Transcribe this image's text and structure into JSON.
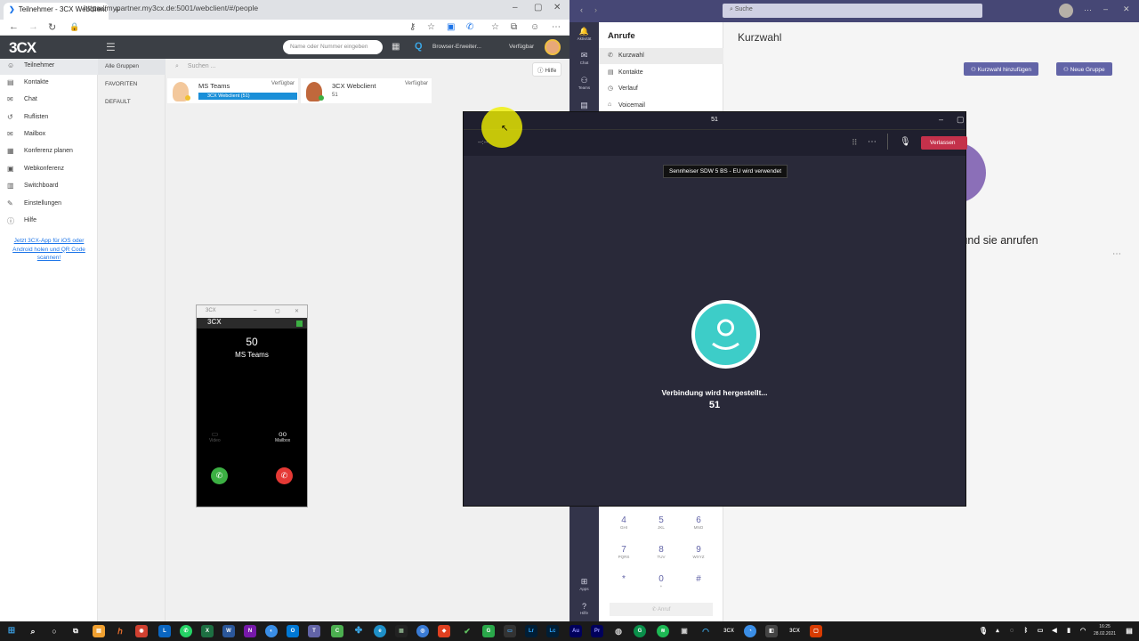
{
  "browser": {
    "tab_title": "Teilnehmer - 3CX Webclient",
    "new_tab": "+",
    "url": "https://mypartner.my3cx.de:5001/webclient/#/people"
  },
  "cx": {
    "logo": "3CX",
    "search_placeholder": "Name oder Nummer eingeben",
    "extension_label": "Browser-Erweiter...",
    "status": "Verfügbar",
    "sidebar": [
      {
        "label": "Teilnehmer",
        "icon": "person-icon"
      },
      {
        "label": "Kontakte",
        "icon": "contacts-icon"
      },
      {
        "label": "Chat",
        "icon": "chat-icon"
      },
      {
        "label": "Ruflisten",
        "icon": "history-icon"
      },
      {
        "label": "Mailbox",
        "icon": "mailbox-icon"
      },
      {
        "label": "Konferenz planen",
        "icon": "calendar-icon"
      },
      {
        "label": "Webkonferenz",
        "icon": "webconference-icon"
      },
      {
        "label": "Switchboard",
        "icon": "switchboard-icon"
      },
      {
        "label": "Einstellungen",
        "icon": "wrench-icon"
      },
      {
        "label": "Hilfe",
        "icon": "info-icon"
      }
    ],
    "side_link": "Jetzt 3CX-App für iOS oder Android holen und QR Code scannen!",
    "groups": [
      "Alle Gruppen",
      "FAVORITEN",
      "DEFAULT"
    ],
    "main_search": "Suchen ...",
    "help": "Hilfe",
    "cards": [
      {
        "name": "MS Teams",
        "status": "Verfügbar",
        "ext": "3CX Webclient (51)"
      },
      {
        "name": "3CX Webclient",
        "status": "Verfügbar",
        "ext": "51"
      }
    ]
  },
  "phone": {
    "title": "3CX",
    "logo": "3CX",
    "number": "50",
    "name": "MS Teams",
    "video": "Video",
    "mailbox": "Mailbox"
  },
  "teams": {
    "search": "Suche",
    "rail": [
      {
        "label": "Aktivität",
        "icon": "bell-icon"
      },
      {
        "label": "Chat",
        "icon": "chat-icon"
      },
      {
        "label": "Teams",
        "icon": "teams-icon"
      },
      {
        "label": "Apps",
        "icon": "apps-icon"
      },
      {
        "label": "Hilfe",
        "icon": "help-icon"
      }
    ],
    "calls_header": "Anrufe",
    "calls_items": [
      "Kurzwahl",
      "Kontakte",
      "Verlauf",
      "Voicemail"
    ],
    "page_title": "Kurzwahl",
    "btn_add": "Kurzwahl hinzufügen",
    "btn_group": "Neue Gruppe",
    "partial_text": "n und sie anrufen",
    "dialpad": [
      {
        "d": "4",
        "l": "GHI"
      },
      {
        "d": "5",
        "l": "JKL"
      },
      {
        "d": "6",
        "l": "MNO"
      },
      {
        "d": "7",
        "l": "PQRS"
      },
      {
        "d": "8",
        "l": "TUV"
      },
      {
        "d": "9",
        "l": "WXYZ"
      },
      {
        "d": "*",
        "l": ""
      },
      {
        "d": "0",
        "l": "+"
      },
      {
        "d": "#",
        "l": ""
      }
    ],
    "call_btn": "Anruf"
  },
  "call": {
    "title": "51",
    "clock": "--:--",
    "leave": "Verlassen",
    "device": "Sennheiser SDW 5 BS - EU wird verwendet",
    "status": "Verbindung wird hergestellt...",
    "number": "51"
  },
  "taskbar": {
    "time": "16:25",
    "date": "28.02.2021"
  },
  "colors": {
    "teams_purple": "#6264a7",
    "cx_blue": "#1a8fd8",
    "leave_red": "#c4314b",
    "avatar_teal": "#3dcdc8"
  }
}
